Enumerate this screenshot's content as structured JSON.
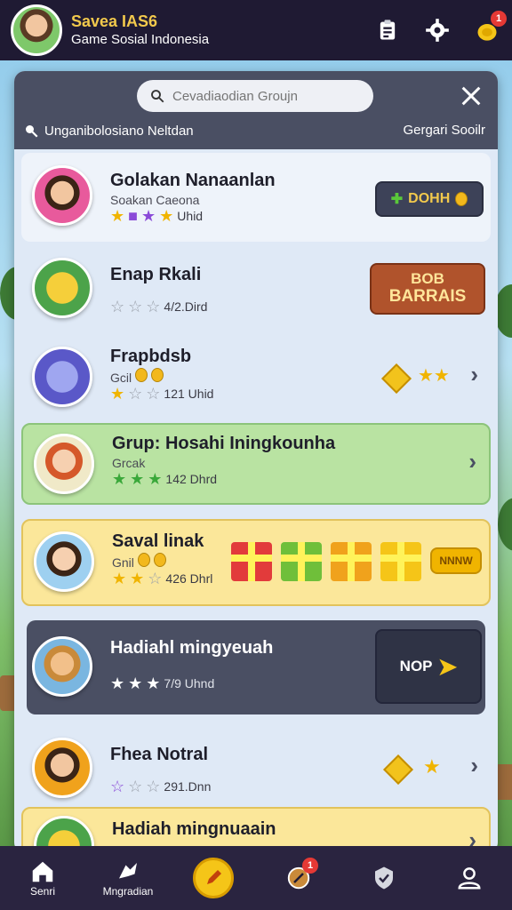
{
  "header": {
    "title": "Savea IAS6",
    "subtitle": "Game Sosial Indonesia",
    "notification_count": "1",
    "icons": [
      "clipboard-icon",
      "gear-icon",
      "coin-icon"
    ]
  },
  "panel": {
    "search": {
      "placeholder": "Cevadiaodian Groujn"
    },
    "filter_left": "Unganibolosiano Neltdan",
    "filter_right": "Gergari Sooilr"
  },
  "rows": [
    {
      "name": "Golakan Nanaanlan",
      "sub": "Soakan Caeona",
      "meta": "Uhid",
      "action": "DOHH"
    },
    {
      "name": "Enap Rkali",
      "meta": "4/2.Dird",
      "action_line1": "BOB",
      "action_line2": "BARRAIS"
    },
    {
      "name": "Frapbdsb",
      "sub": "Gcil",
      "meta": "121 Uhid"
    },
    {
      "name": "Grup: Hosahi Iningkounha",
      "sub": "Grcak",
      "meta": "142 Dhrd"
    },
    {
      "name": "Saval linak",
      "sub": "Gnil",
      "meta": "426 Dhrl",
      "action": "NNNW"
    },
    {
      "name": "Hadiahl mingyeuah",
      "meta": "7/9 Uhnd",
      "action": "NOP"
    },
    {
      "name": "Fhea Notral",
      "meta": "291.Dnn"
    },
    {
      "name": "Hadiah mingnuaain"
    }
  ],
  "bottom_nav": [
    {
      "label": "Senri",
      "icon": "home-icon"
    },
    {
      "label": "Mngradian",
      "icon": "bird-icon"
    },
    {
      "label": "",
      "icon": "pencil-icon"
    },
    {
      "label": "",
      "icon": "badge-icon",
      "badge": "1"
    },
    {
      "label": "",
      "icon": "shield-icon"
    },
    {
      "label": "",
      "icon": "user-icon"
    }
  ],
  "colors": {
    "topbar": "#1f1a33",
    "panel_header": "#4a4f63",
    "highlight_green": "#b9e3a2",
    "highlight_yellow": "#fbe79a",
    "dark_row": "#4a4f63",
    "accent_gold": "#f2c94c"
  }
}
